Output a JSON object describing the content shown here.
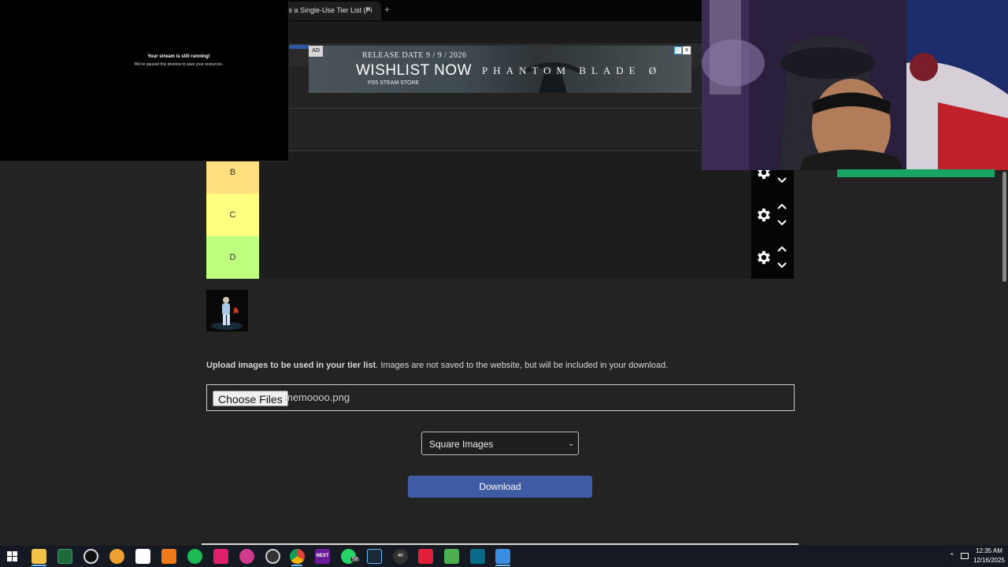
{
  "browser": {
    "tab_title": "e a Single-Use Tier List (Pi",
    "tab_close": "×",
    "tab_new": "+"
  },
  "ad": {
    "badge": "AD",
    "release_date": "RELEASE DATE  9 / 9 / 2026",
    "headline": "WISHLIST NOW",
    "game_title": "PHANTOM BLADE Ø",
    "platforms": "PS5   STEAM   STORE",
    "info_icon": "info-icon",
    "close_icon": "close-icon"
  },
  "stream_preview": {
    "title": "Your stream is still running!",
    "subtitle": "We've paused this preview to save your resources."
  },
  "tiers": [
    {
      "label": "B",
      "color": "#ffdf80"
    },
    {
      "label": "C",
      "color": "#ffff7f"
    },
    {
      "label": "D",
      "color": "#bfff7f"
    }
  ],
  "upload": {
    "label_bold": "Upload images to be used in your tier list",
    "label_rest": ". Images are not saved to the website, but will be included in your download.",
    "choose_button": "Choose Files",
    "file_name": "memoooo.png"
  },
  "image_shape_select": {
    "selected": "Square Images"
  },
  "download_button": "Download",
  "taskbar": {
    "time": "12:35 AM",
    "date": "12/16/2025",
    "whatsapp_badge": "58",
    "icons": [
      "windows-start-icon",
      "file-explorer-icon",
      "terminal-icon",
      "obs-icon",
      "discord-icon",
      "capcut-icon",
      "app-orange-icon",
      "spotify-icon",
      "tiktok-icon",
      "chrome-canary-icon",
      "app-outline-icon",
      "chrome-icon",
      "next-icon",
      "whatsapp-icon",
      "steam-icon",
      "4k-icon",
      "app-red-icon",
      "minecraft-icon",
      "app-cyan-icon",
      "paint-icon"
    ]
  },
  "colors": {
    "accent": "#3e5ba4",
    "page_bg": "#232323",
    "webcam_bar": "#18a464"
  }
}
